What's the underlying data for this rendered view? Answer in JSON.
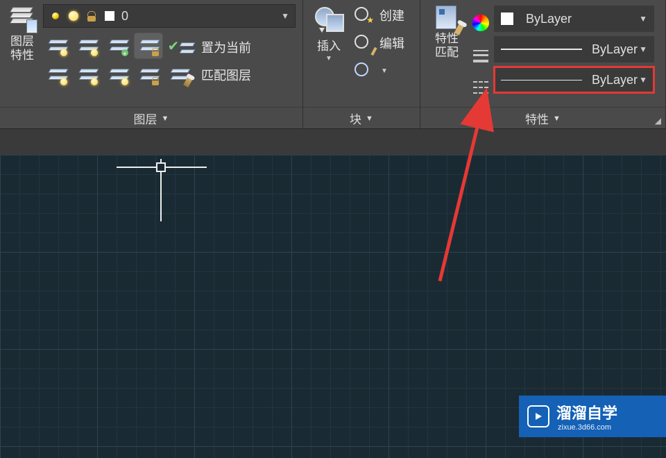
{
  "ribbon": {
    "layers_panel": {
      "big_button": "图层\n特性",
      "dropdown": {
        "value": "0"
      },
      "row1_label": "置为当前",
      "row2_label": "匹配图层",
      "title": "图层"
    },
    "blocks_panel": {
      "insert_label": "插入",
      "create_label": "创建",
      "edit_label": "编辑",
      "title": "块"
    },
    "props_panel": {
      "match_label": "特性\n匹配",
      "row_color": "ByLayer",
      "row_lw": "ByLayer",
      "row_lt": "ByLayer",
      "title": "特性"
    }
  },
  "watermark": {
    "brand": "溜溜自学",
    "url": "zixue.3d66.com"
  }
}
